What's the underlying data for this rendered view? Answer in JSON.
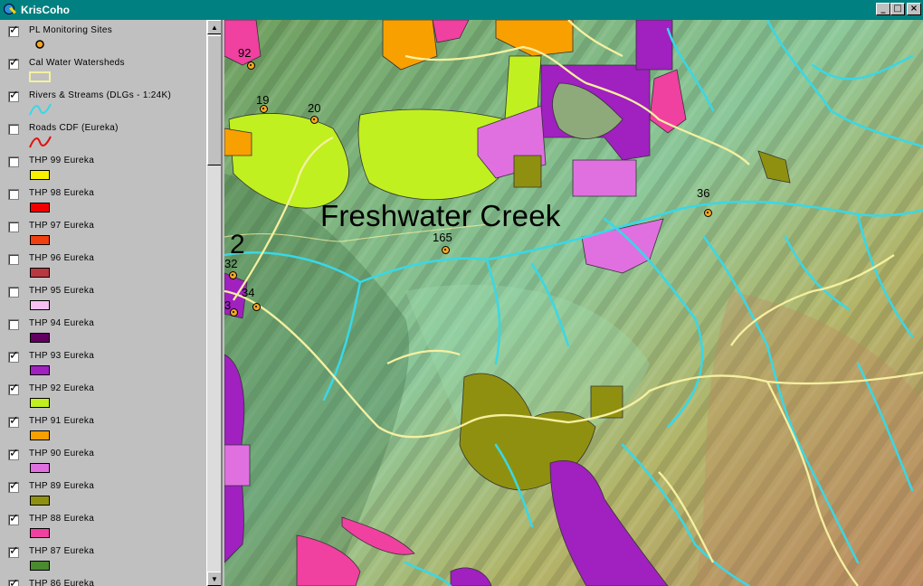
{
  "window": {
    "title": "KrisCoho",
    "buttons": {
      "minimize": "_",
      "maximize": "□",
      "close": "×"
    }
  },
  "toc": {
    "layers": [
      {
        "name": "PL Monitoring Sites",
        "checked": true,
        "symbol": "point",
        "color": "#f5a623"
      },
      {
        "name": "Cal Water Watersheds",
        "checked": true,
        "symbol": "outline",
        "color": "#f5f0a0"
      },
      {
        "name": "Rivers & Streams (DLGs - 1:24K)",
        "checked": true,
        "symbol": "line",
        "color": "#38d8e8"
      },
      {
        "name": "Roads CDF (Eureka)",
        "checked": false,
        "symbol": "line",
        "color": "#e01010"
      },
      {
        "name": "THP 99 Eureka",
        "checked": false,
        "symbol": "fill",
        "color": "#f8f000"
      },
      {
        "name": "THP 98 Eureka",
        "checked": false,
        "symbol": "fill",
        "color": "#f00000"
      },
      {
        "name": "THP 97 Eureka",
        "checked": false,
        "symbol": "fill",
        "color": "#f04010"
      },
      {
        "name": "THP 96 Eureka",
        "checked": false,
        "symbol": "fill",
        "color": "#b83840"
      },
      {
        "name": "THP 95 Eureka",
        "checked": false,
        "symbol": "fill",
        "color": "#f8c0f0"
      },
      {
        "name": "THP 94 Eureka",
        "checked": false,
        "symbol": "fill",
        "color": "#600060"
      },
      {
        "name": "THP 93 Eureka",
        "checked": true,
        "symbol": "fill",
        "color": "#a020c0"
      },
      {
        "name": "THP 92 Eureka",
        "checked": true,
        "symbol": "fill",
        "color": "#c0f020"
      },
      {
        "name": "THP 91 Eureka",
        "checked": true,
        "symbol": "fill",
        "color": "#f8a000"
      },
      {
        "name": "THP 90 Eureka",
        "checked": true,
        "symbol": "fill",
        "color": "#e070e0"
      },
      {
        "name": "THP 89 Eureka",
        "checked": true,
        "symbol": "fill",
        "color": "#909010"
      },
      {
        "name": "THP 88 Eureka",
        "checked": true,
        "symbol": "fill",
        "color": "#f040a0"
      },
      {
        "name": "THP 87 Eureka",
        "checked": true,
        "symbol": "fill",
        "color": "#4a8a30"
      },
      {
        "name": "THP 86 Eureka",
        "checked": true,
        "symbol": "fill",
        "color": "#c0c0c0"
      }
    ]
  },
  "map": {
    "creek_label": "Freshwater Creek",
    "watershed_number": "2",
    "sites": [
      "92",
      "19",
      "20",
      "36",
      "165",
      "34",
      "32",
      "3"
    ]
  }
}
